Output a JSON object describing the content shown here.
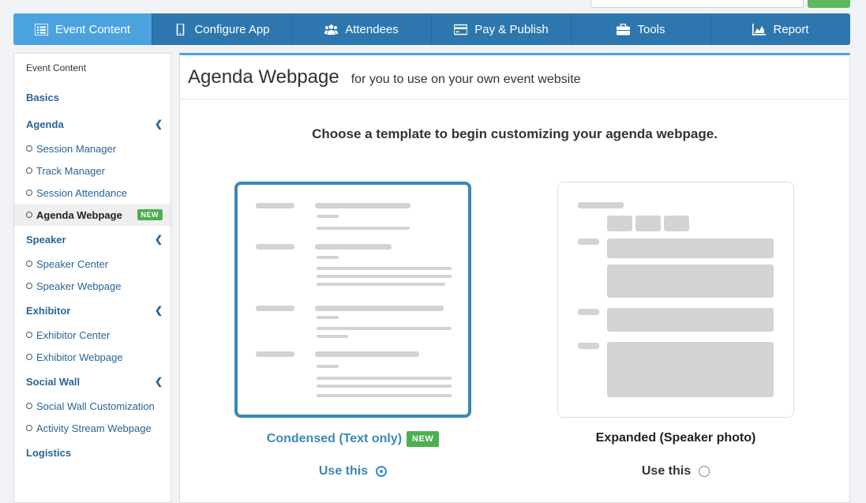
{
  "nav": {
    "tabs": [
      {
        "label": "Event Content",
        "icon": "list-icon",
        "active": true
      },
      {
        "label": "Configure App",
        "icon": "phone-icon"
      },
      {
        "label": "Attendees",
        "icon": "users-icon"
      },
      {
        "label": "Pay & Publish",
        "icon": "credit-card-icon"
      },
      {
        "label": "Tools",
        "icon": "briefcase-icon"
      },
      {
        "label": "Report",
        "icon": "area-chart-icon"
      }
    ]
  },
  "sidebar": {
    "header": "Event Content",
    "basics": "Basics",
    "agenda": {
      "label": "Agenda",
      "items": [
        "Session Manager",
        "Track Manager",
        "Session Attendance",
        "Agenda Webpage"
      ],
      "active_badge": "NEW"
    },
    "speaker": {
      "label": "Speaker",
      "items": [
        "Speaker Center",
        "Speaker Webpage"
      ]
    },
    "exhibitor": {
      "label": "Exhibitor",
      "items": [
        "Exhibitor Center",
        "Exhibitor Webpage"
      ]
    },
    "social": {
      "label": "Social Wall",
      "items": [
        "Social Wall Customization",
        "Activity Stream Webpage"
      ]
    },
    "logistics": "Logistics"
  },
  "main": {
    "title": "Agenda Webpage",
    "subtitle": "for you to use on your own event website",
    "prompt": "Choose a template to begin customizing your agenda webpage.",
    "templates": [
      {
        "label": "Condensed (Text only)",
        "badge": "NEW",
        "use": "Use this",
        "selected": true
      },
      {
        "label": "Expanded (Speaker photo)",
        "use": "Use this",
        "selected": false
      }
    ]
  },
  "colors": {
    "nav": "#2e77ae",
    "nav_active": "#4aa3df",
    "link": "#2a6496",
    "badge": "#4caf50",
    "selected_border": "#3b87b6"
  }
}
